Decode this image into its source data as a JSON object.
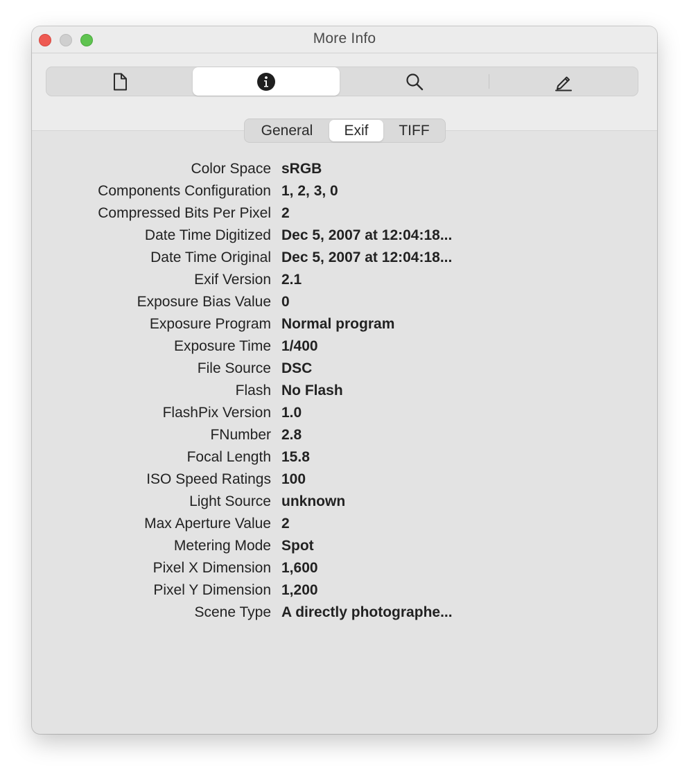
{
  "window": {
    "title": "More Info"
  },
  "toolbar": {
    "buttons": [
      {
        "icon": "document-icon",
        "selected": false
      },
      {
        "icon": "info-icon",
        "selected": true
      },
      {
        "icon": "magnifier-icon",
        "selected": false
      },
      {
        "icon": "pencil-icon",
        "selected": false
      }
    ]
  },
  "tabs": {
    "items": [
      "General",
      "Exif",
      "TIFF"
    ],
    "selected": "Exif"
  },
  "info": {
    "rows": [
      {
        "label": "Color Space",
        "value": "sRGB"
      },
      {
        "label": "Components Configuration",
        "value": "1, 2, 3, 0"
      },
      {
        "label": "Compressed Bits Per Pixel",
        "value": "2"
      },
      {
        "label": "Date Time Digitized",
        "value": "Dec 5, 2007 at 12:04:18..."
      },
      {
        "label": "Date Time Original",
        "value": "Dec 5, 2007 at 12:04:18..."
      },
      {
        "label": "Exif Version",
        "value": "2.1"
      },
      {
        "label": "Exposure Bias Value",
        "value": "0"
      },
      {
        "label": "Exposure Program",
        "value": "Normal program"
      },
      {
        "label": "Exposure Time",
        "value": "1/400"
      },
      {
        "label": "File Source",
        "value": "DSC"
      },
      {
        "label": "Flash",
        "value": "No Flash"
      },
      {
        "label": "FlashPix Version",
        "value": "1.0"
      },
      {
        "label": "FNumber",
        "value": "2.8"
      },
      {
        "label": "Focal Length",
        "value": "15.8"
      },
      {
        "label": "ISO Speed Ratings",
        "value": "100"
      },
      {
        "label": "Light Source",
        "value": "unknown"
      },
      {
        "label": "Max Aperture Value",
        "value": "2"
      },
      {
        "label": "Metering Mode",
        "value": "Spot"
      },
      {
        "label": "Pixel X Dimension",
        "value": "1,600"
      },
      {
        "label": "Pixel Y Dimension",
        "value": "1,200"
      },
      {
        "label": "Scene Type",
        "value": "A directly photographe..."
      }
    ]
  }
}
